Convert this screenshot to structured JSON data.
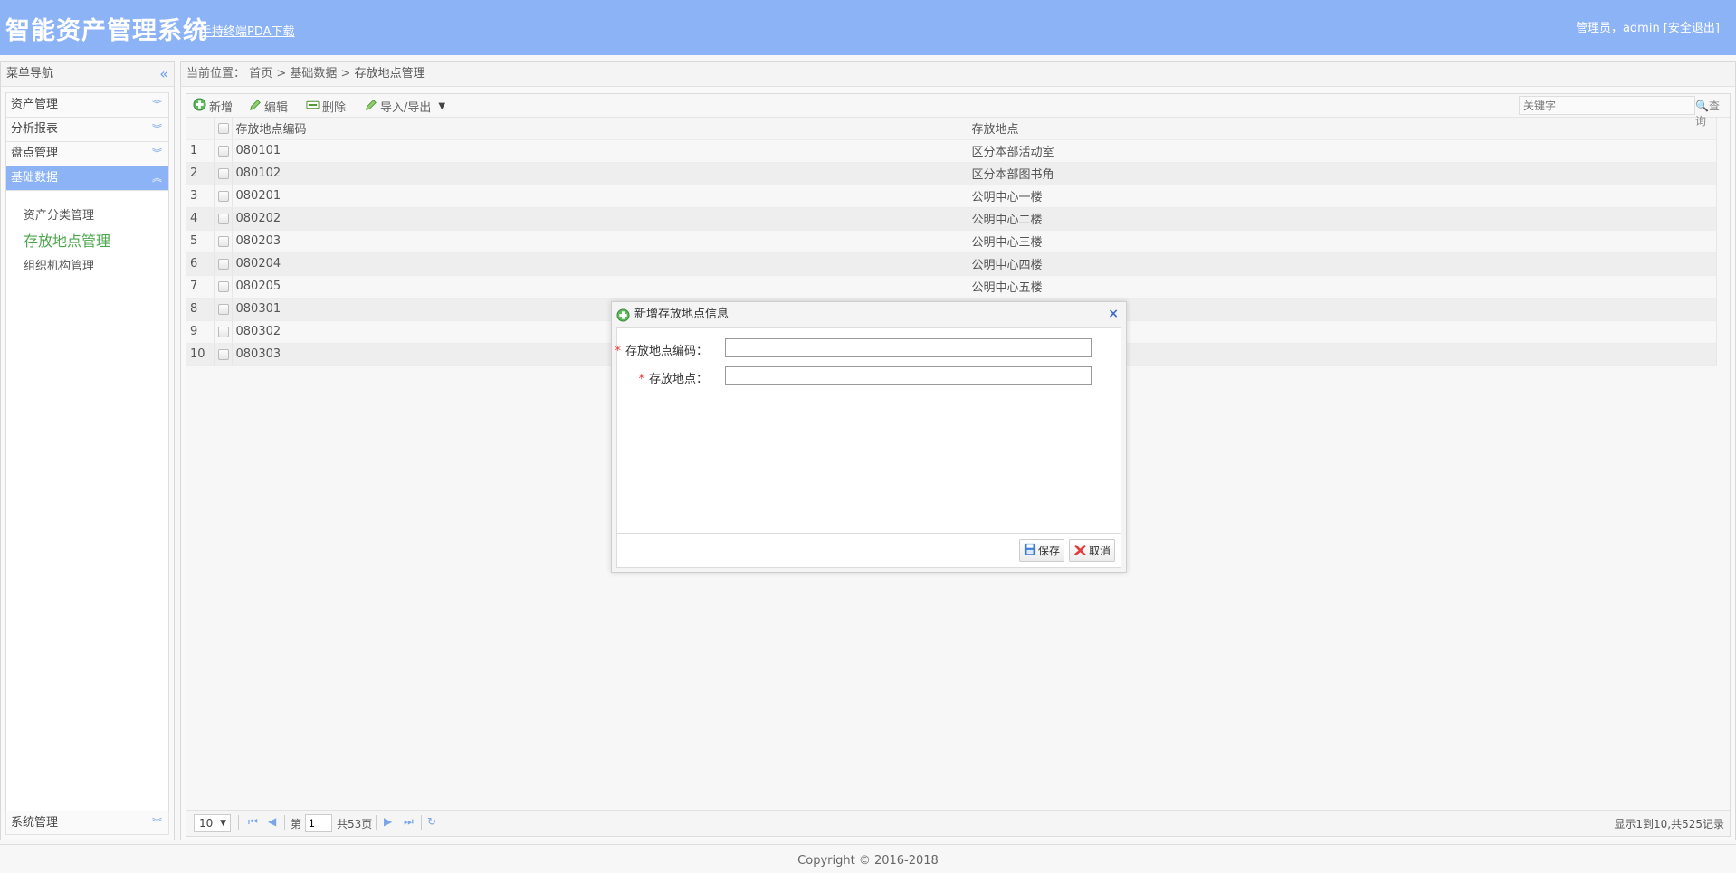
{
  "header": {
    "title": "智能资产管理系统",
    "pda_link": "手持终端PDA下载",
    "user_text": "管理员，admin",
    "logout": "[安全退出]"
  },
  "sidebar": {
    "title": "菜单导航",
    "items": [
      {
        "label": "资产管理"
      },
      {
        "label": "分析报表"
      },
      {
        "label": "盘点管理"
      },
      {
        "label": "基础数据"
      }
    ],
    "sub_items": [
      {
        "label": "资产分类管理"
      },
      {
        "label": "存放地点管理"
      },
      {
        "label": "组织机构管理"
      }
    ],
    "bottom_item": "系统管理"
  },
  "breadcrumb": {
    "prefix": "当前位置：",
    "home": "首页",
    "sep": ">",
    "level2": "基础数据",
    "current": "存放地点管理"
  },
  "toolbar": {
    "add": "新增",
    "edit": "编辑",
    "delete": "删除",
    "import_export": "导入/导出",
    "search_placeholder": "关键字",
    "search": "查询"
  },
  "table": {
    "columns": [
      "存放地点编码",
      "存放地点"
    ],
    "rows": [
      {
        "n": "1",
        "code": "080101",
        "place": "区分本部活动室"
      },
      {
        "n": "2",
        "code": "080102",
        "place": "区分本部图书角"
      },
      {
        "n": "3",
        "code": "080201",
        "place": "公明中心一楼"
      },
      {
        "n": "4",
        "code": "080202",
        "place": "公明中心二楼"
      },
      {
        "n": "5",
        "code": "080203",
        "place": "公明中心三楼"
      },
      {
        "n": "6",
        "code": "080204",
        "place": "公明中心四楼"
      },
      {
        "n": "7",
        "code": "080205",
        "place": "公明中心五楼"
      },
      {
        "n": "8",
        "code": "080301",
        "place": ""
      },
      {
        "n": "9",
        "code": "080302",
        "place": ""
      },
      {
        "n": "10",
        "code": "080303",
        "place": ""
      }
    ]
  },
  "pager": {
    "page_size": "10",
    "page_label": "第",
    "page_value": "1",
    "total_pages": "共53页",
    "info": "显示1到10,共525记录"
  },
  "dialog": {
    "title": "新增存放地点信息",
    "close": "×",
    "field_code_label": "存放地点编码：",
    "field_place_label": "存放地点：",
    "required_mark": "*",
    "field_code_value": "",
    "field_place_value": "",
    "save": "保存",
    "cancel": "取消"
  },
  "footer": {
    "copyright": "Copyright © 2016-2018"
  },
  "colors": {
    "header_bg": "#8cb3f5",
    "active_sub": "#4ca64c",
    "required": "#e33333"
  }
}
